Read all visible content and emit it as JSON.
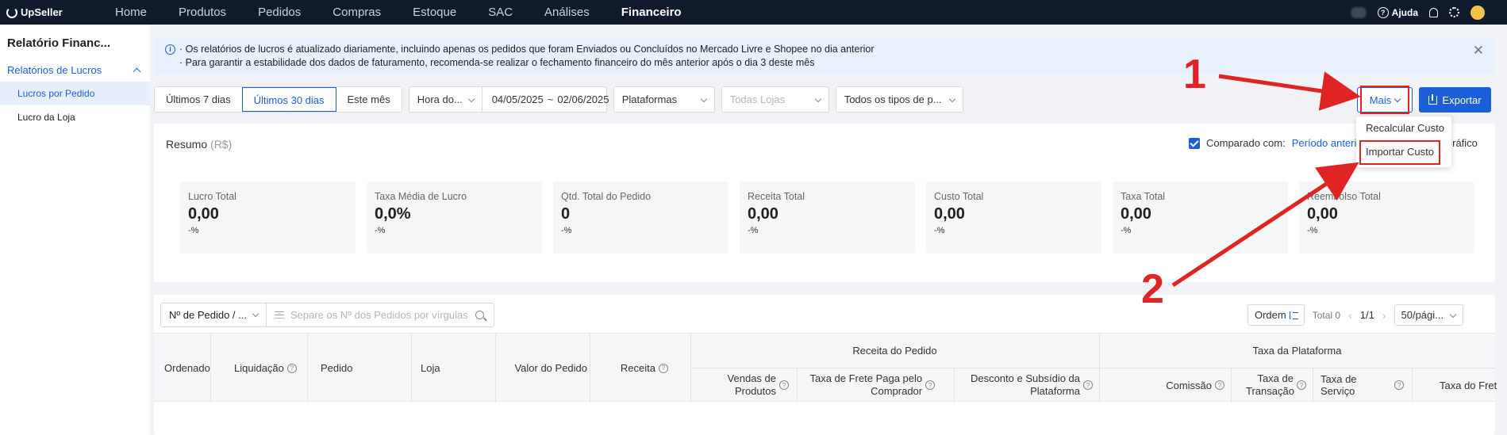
{
  "nav": {
    "brand": "UpSeller",
    "items": [
      "Home",
      "Produtos",
      "Pedidos",
      "Compras",
      "Estoque",
      "SAC",
      "Análises",
      "Financeiro"
    ],
    "active": "Financeiro",
    "help": "Ajuda"
  },
  "sidebar": {
    "title": "Relatório Financ...",
    "group": "Relatórios de Lucros",
    "items": [
      "Lucros por Pedido",
      "Lucro da Loja"
    ]
  },
  "notice": {
    "line1": "· Os relatórios de lucros é atualizado diariamente, incluindo apenas os pedidos que foram Enviados ou Concluídos no Mercado Livre e Shopee no dia anterior",
    "line2": "· Para garantir a estabilidade dos dados de faturamento, recomenda-se realizar o fechamento financeiro do mês anterior após o dia 3 deste mês"
  },
  "filters": {
    "ranges": [
      "Últimos 7 dias",
      "Últimos 30 dias",
      "Este mês"
    ],
    "active_range": "Últimos 30 dias",
    "time_type": "Hora do...",
    "date_start": "04/05/2025",
    "date_sep": "~",
    "date_end": "02/06/2025",
    "platforms": "Plataformas",
    "stores_placeholder": "Todas Lojas",
    "types": "Todos os tipos de p..."
  },
  "actions": {
    "more": "Mais",
    "export": "Exportar",
    "menu": [
      "Recalcular Custo",
      "Importar Custo"
    ]
  },
  "summary": {
    "title": "Resumo",
    "unit": "(R$)",
    "compare_label": "Comparado com:",
    "compare_value": "Período anterior",
    "chart_label": "Gráfico",
    "cards": [
      {
        "label": "Lucro Total",
        "value": "0,00",
        "pct": "-%"
      },
      {
        "label": "Taxa Média de Lucro",
        "value": "0,0%",
        "pct": "-%"
      },
      {
        "label": "Qtd. Total do Pedido",
        "value": "0",
        "pct": "-%"
      },
      {
        "label": "Receita Total",
        "value": "0,00",
        "pct": "-%"
      },
      {
        "label": "Custo Total",
        "value": "0,00",
        "pct": "-%"
      },
      {
        "label": "Taxa Total",
        "value": "0,00",
        "pct": "-%"
      },
      {
        "label": "Reembolso Total",
        "value": "0,00",
        "pct": "-%"
      }
    ]
  },
  "table": {
    "search_type": "Nº de Pedido / ...",
    "search_placeholder": "Separe os Nº dos Pedidos por vírgulas",
    "order_btn": "Ordem",
    "total": "Total 0",
    "page": "1/1",
    "per_page": "50/pági...",
    "headers": {
      "ordenado": "Ordenado",
      "liquidacao": "Liquidação",
      "pedido": "Pedido",
      "loja": "Loja",
      "valor": "Valor do Pedido",
      "receita": "Receita",
      "group_receita": "Receita do Pedido",
      "vendas": "Vendas de Produtos",
      "frete": "Taxa de Frete Paga pelo Comprador",
      "desconto": "Desconto e Subsídio da Plataforma",
      "group_taxa": "Taxa da Plataforma",
      "comissao": "Comissão",
      "transacao": "Taxa de Transação",
      "servico": "Taxa de Serviço",
      "taxa_frete": "Taxa do Fret"
    }
  },
  "annotations": {
    "one": "1",
    "two": "2",
    "color": "#e02424"
  }
}
